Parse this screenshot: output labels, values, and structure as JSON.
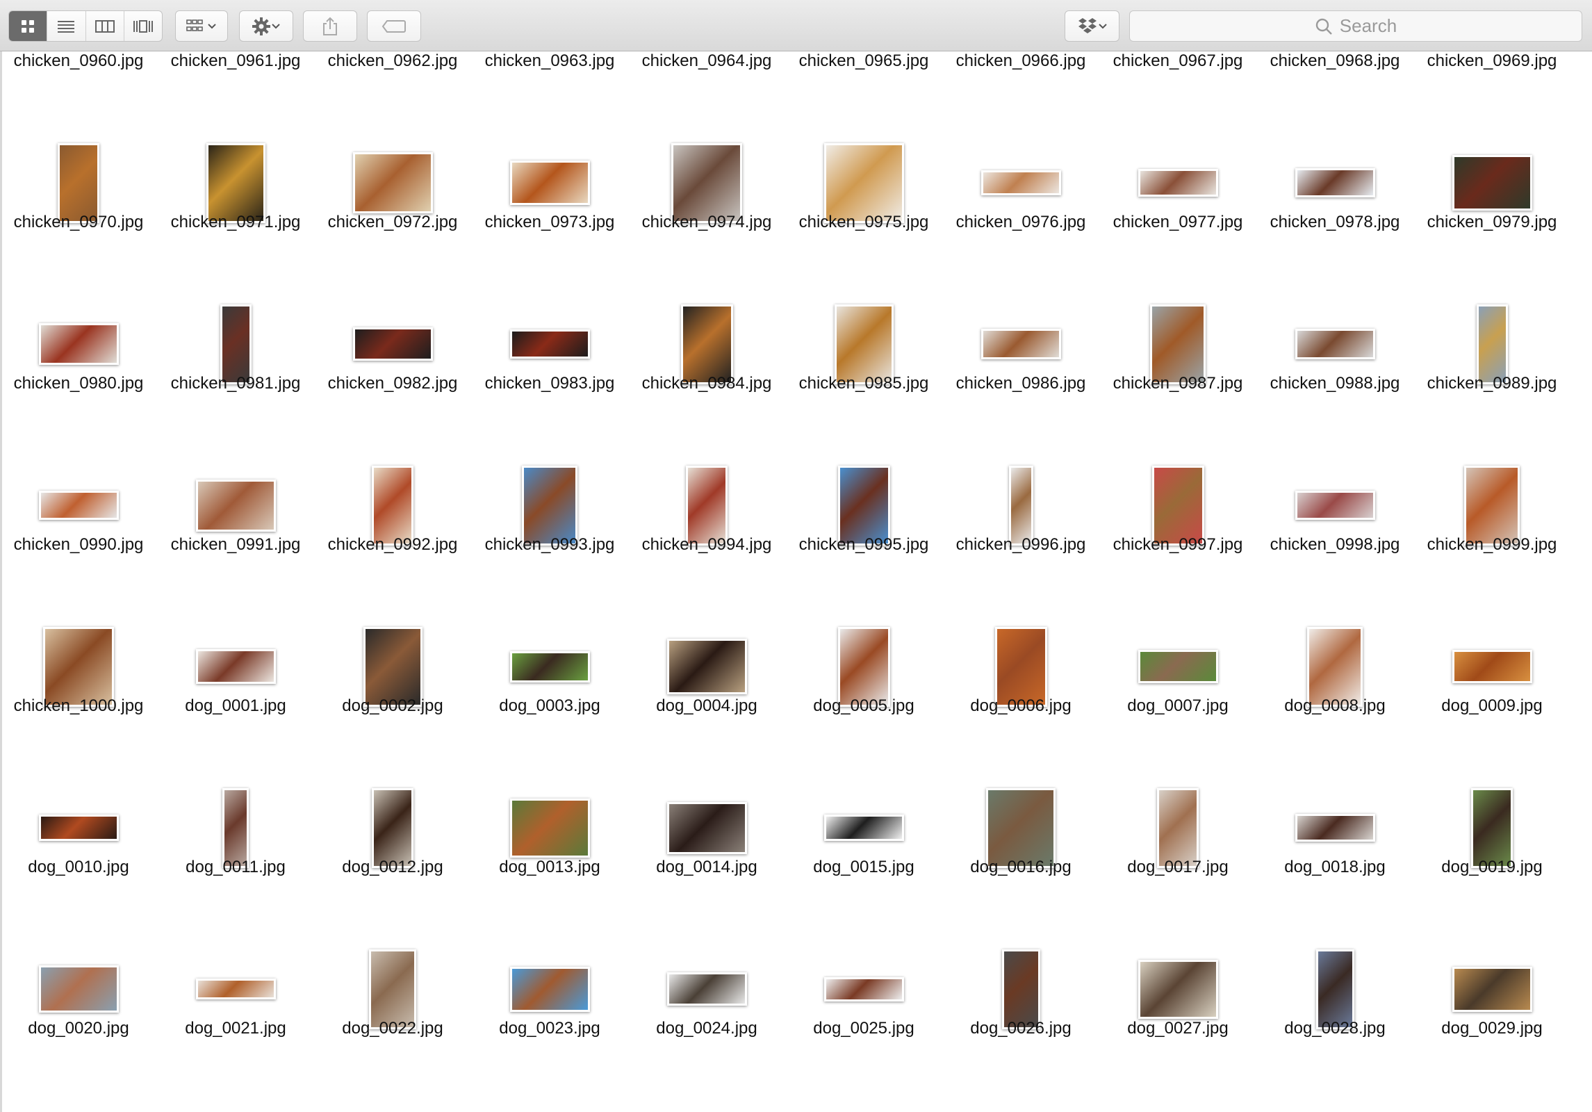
{
  "toolbar": {
    "view_modes": [
      "icon-view",
      "list-view",
      "column-view",
      "cover-flow-view"
    ],
    "active_view": "icon-view",
    "search_placeholder": "Search"
  },
  "files": [
    {
      "name": "chicken_0960.jpg",
      "w": 20,
      "h": 75,
      "c1": "#b87a3c",
      "c2": "#e9e2d4"
    },
    {
      "name": "chicken_0961.jpg",
      "w": 115,
      "h": 50,
      "c1": "#8a4a24",
      "c2": "#d8cdb8"
    },
    {
      "name": "chicken_0962.jpg",
      "w": 78,
      "h": 75,
      "c1": "#7a3a28",
      "c2": "#e5d6c8"
    },
    {
      "name": "chicken_0963.jpg",
      "w": 88,
      "h": 75,
      "c1": "#b0602a",
      "c2": "#3a3a3a"
    },
    {
      "name": "chicken_0964.jpg",
      "w": 115,
      "h": 42,
      "c1": "#8a5030",
      "c2": "#d0c8b8"
    },
    {
      "name": "chicken_0965.jpg",
      "w": 85,
      "h": 75,
      "c1": "#b8621c",
      "c2": "#c47a38"
    },
    {
      "name": "chicken_0966.jpg",
      "w": 38,
      "h": 75,
      "c1": "#7a4a30",
      "c2": "#ddd"
    },
    {
      "name": "chicken_0967.jpg",
      "w": 115,
      "h": 42,
      "c1": "#b04020",
      "c2": "#e8e0d0"
    },
    {
      "name": "chicken_0968.jpg",
      "w": 38,
      "h": 75,
      "c1": "#9a5030",
      "c2": "#e6e6e6"
    },
    {
      "name": "chicken_0969.jpg",
      "w": 108,
      "h": 75,
      "c1": "#9a4a1c",
      "c2": "#e9e2d8"
    },
    {
      "name": "chicken_0970.jpg",
      "w": 60,
      "h": 115,
      "c1": "#b8702c",
      "c2": "#8a5a30"
    },
    {
      "name": "chicken_0971.jpg",
      "w": 85,
      "h": 115,
      "c1": "#c89230",
      "c2": "#2a2418"
    },
    {
      "name": "chicken_0972.jpg",
      "w": 115,
      "h": 88,
      "c1": "#a86030",
      "c2": "#e0d0b0"
    },
    {
      "name": "chicken_0973.jpg",
      "w": 115,
      "h": 64,
      "c1": "#b4561c",
      "c2": "#e8d8c0"
    },
    {
      "name": "chicken_0974.jpg",
      "w": 102,
      "h": 115,
      "c1": "#6a4a3a",
      "c2": "#c8c4c0"
    },
    {
      "name": "chicken_0975.jpg",
      "w": 115,
      "h": 115,
      "c1": "#d09a50",
      "c2": "#f0ece6"
    },
    {
      "name": "chicken_0976.jpg",
      "w": 115,
      "h": 36,
      "c1": "#c08050",
      "c2": "#ece6e0"
    },
    {
      "name": "chicken_0977.jpg",
      "w": 115,
      "h": 40,
      "c1": "#8a5038",
      "c2": "#e8e4de"
    },
    {
      "name": "chicken_0978.jpg",
      "w": 115,
      "h": 42,
      "c1": "#6a3a28",
      "c2": "#e6ebf0"
    },
    {
      "name": "chicken_0979.jpg",
      "w": 115,
      "h": 80,
      "c1": "#6a2a1c",
      "c2": "#2e3a2a"
    },
    {
      "name": "chicken_0980.jpg",
      "w": 115,
      "h": 60,
      "c1": "#9a3420",
      "c2": "#e0ddd6"
    },
    {
      "name": "chicken_0981.jpg",
      "w": 45,
      "h": 115,
      "c1": "#6a3024",
      "c2": "#3a3a3a"
    },
    {
      "name": "chicken_0982.jpg",
      "w": 115,
      "h": 48,
      "c1": "#7a2a1c",
      "c2": "#1e1e1e"
    },
    {
      "name": "chicken_0983.jpg",
      "w": 115,
      "h": 42,
      "c1": "#8a2a18",
      "c2": "#1c1c1c"
    },
    {
      "name": "chicken_0984.jpg",
      "w": 75,
      "h": 115,
      "c1": "#b8702c",
      "c2": "#222"
    },
    {
      "name": "chicken_0985.jpg",
      "w": 85,
      "h": 115,
      "c1": "#b8782a",
      "c2": "#e8e4de"
    },
    {
      "name": "chicken_0986.jpg",
      "w": 115,
      "h": 44,
      "c1": "#9a5a30",
      "c2": "#e0dcd6"
    },
    {
      "name": "chicken_0987.jpg",
      "w": 80,
      "h": 115,
      "c1": "#a05a28",
      "c2": "#9aa4a8"
    },
    {
      "name": "chicken_0988.jpg",
      "w": 115,
      "h": 44,
      "c1": "#7a4a30",
      "c2": "#d8d8d8"
    },
    {
      "name": "chicken_0989.jpg",
      "w": 45,
      "h": 115,
      "c1": "#c8a050",
      "c2": "#8aa0b8"
    },
    {
      "name": "chicken_0990.jpg",
      "w": 115,
      "h": 42,
      "c1": "#c06030",
      "c2": "#e6e6e6"
    },
    {
      "name": "chicken_0991.jpg",
      "w": 115,
      "h": 75,
      "c1": "#a05a38",
      "c2": "#d8c8b8"
    },
    {
      "name": "chicken_0992.jpg",
      "w": 60,
      "h": 115,
      "c1": "#b04a28",
      "c2": "#e8dcc8"
    },
    {
      "name": "chicken_0993.jpg",
      "w": 80,
      "h": 115,
      "c1": "#8a4a28",
      "c2": "#4a8ac8"
    },
    {
      "name": "chicken_0994.jpg",
      "w": 60,
      "h": 115,
      "c1": "#a03a28",
      "c2": "#e6e0d6"
    },
    {
      "name": "chicken_0995.jpg",
      "w": 75,
      "h": 115,
      "c1": "#6a3020",
      "c2": "#4a90d0"
    },
    {
      "name": "chicken_0996.jpg",
      "w": 35,
      "h": 115,
      "c1": "#9a6a40",
      "c2": "#eaeaea"
    },
    {
      "name": "chicken_0997.jpg",
      "w": 75,
      "h": 115,
      "c1": "#9a6a38",
      "c2": "#c84a48"
    },
    {
      "name": "chicken_0998.jpg",
      "w": 115,
      "h": 42,
      "c1": "#9a4a48",
      "c2": "#d8d0d0"
    },
    {
      "name": "chicken_0999.jpg",
      "w": 80,
      "h": 115,
      "c1": "#b85a28",
      "c2": "#d4c4b8"
    },
    {
      "name": "chicken_1000.jpg",
      "w": 102,
      "h": 115,
      "c1": "#8a4a24",
      "c2": "#d8c0a0"
    },
    {
      "name": "dog_0001.jpg",
      "w": 115,
      "h": 50,
      "c1": "#7a3a28",
      "c2": "#ece6e0"
    },
    {
      "name": "dog_0002.jpg",
      "w": 85,
      "h": 115,
      "c1": "#8a5a38",
      "c2": "#2a2a2a"
    },
    {
      "name": "dog_0003.jpg",
      "w": 115,
      "h": 45,
      "c1": "#3a2a20",
      "c2": "#6aa040"
    },
    {
      "name": "dog_0004.jpg",
      "w": 115,
      "h": 80,
      "c1": "#2a1a14",
      "c2": "#b8a080"
    },
    {
      "name": "dog_0005.jpg",
      "w": 75,
      "h": 115,
      "c1": "#9a4a24",
      "c2": "#eaeaea"
    },
    {
      "name": "dog_0006.jpg",
      "w": 75,
      "h": 115,
      "c1": "#9a4a24",
      "c2": "#c86828"
    },
    {
      "name": "dog_0007.jpg",
      "w": 115,
      "h": 48,
      "c1": "#8a6a50",
      "c2": "#5a8a3a"
    },
    {
      "name": "dog_0008.jpg",
      "w": 80,
      "h": 115,
      "c1": "#b06840",
      "c2": "#f0ece8"
    },
    {
      "name": "dog_0009.jpg",
      "w": 115,
      "h": 48,
      "c1": "#a04a18",
      "c2": "#d89040"
    },
    {
      "name": "dog_0010.jpg",
      "w": 115,
      "h": 38,
      "c1": "#b04a20",
      "c2": "#2a1a14"
    },
    {
      "name": "dog_0011.jpg",
      "w": 38,
      "h": 115,
      "c1": "#6a3a2c",
      "c2": "#b8a8a0"
    },
    {
      "name": "dog_0012.jpg",
      "w": 60,
      "h": 115,
      "c1": "#3a2418",
      "c2": "#c8c0b4"
    },
    {
      "name": "dog_0013.jpg",
      "w": 115,
      "h": 85,
      "c1": "#b0602c",
      "c2": "#5a7a3a"
    },
    {
      "name": "dog_0014.jpg",
      "w": 115,
      "h": 75,
      "c1": "#2a1c18",
      "c2": "#8a8078"
    },
    {
      "name": "dog_0015.jpg",
      "w": 115,
      "h": 38,
      "c1": "#1e1e1e",
      "c2": "#f0f0f0"
    },
    {
      "name": "dog_0016.jpg",
      "w": 100,
      "h": 115,
      "c1": "#7a5a40",
      "c2": "#6a7a6a"
    },
    {
      "name": "dog_0017.jpg",
      "w": 60,
      "h": 115,
      "c1": "#a07050",
      "c2": "#d8d0c8"
    },
    {
      "name": "dog_0018.jpg",
      "w": 115,
      "h": 40,
      "c1": "#4a2a20",
      "c2": "#d8d4d0"
    },
    {
      "name": "dog_0019.jpg",
      "w": 60,
      "h": 115,
      "c1": "#3a2a20",
      "c2": "#6a8a4a"
    },
    {
      "name": "dog_0020.jpg",
      "w": 115,
      "h": 68,
      "c1": "#b07050",
      "c2": "#8aa0b0"
    },
    {
      "name": "dog_0021.jpg",
      "w": 115,
      "h": 30,
      "c1": "#b0602a",
      "c2": "#e8e0d8"
    },
    {
      "name": "dog_0022.jpg",
      "w": 68,
      "h": 115,
      "c1": "#8a6a50",
      "c2": "#c8bcae"
    },
    {
      "name": "dog_0023.jpg",
      "w": 115,
      "h": 65,
      "c1": "#a05a30",
      "c2": "#4a9ad8"
    },
    {
      "name": "dog_0024.jpg",
      "w": 115,
      "h": 48,
      "c1": "#4a4036",
      "c2": "#e8e8e8"
    },
    {
      "name": "dog_0025.jpg",
      "w": 115,
      "h": 35,
      "c1": "#7a3a24",
      "c2": "#eeeeee"
    },
    {
      "name": "dog_0026.jpg",
      "w": 55,
      "h": 115,
      "c1": "#6a3a24",
      "c2": "#4a4a4a"
    },
    {
      "name": "dog_0027.jpg",
      "w": 115,
      "h": 85,
      "c1": "#5a4434",
      "c2": "#d8d0c0"
    },
    {
      "name": "dog_0028.jpg",
      "w": 55,
      "h": 115,
      "c1": "#3a2a24",
      "c2": "#6a7a9a"
    },
    {
      "name": "dog_0029.jpg",
      "w": 115,
      "h": 65,
      "c1": "#4a3a2a",
      "c2": "#b88a50"
    }
  ]
}
